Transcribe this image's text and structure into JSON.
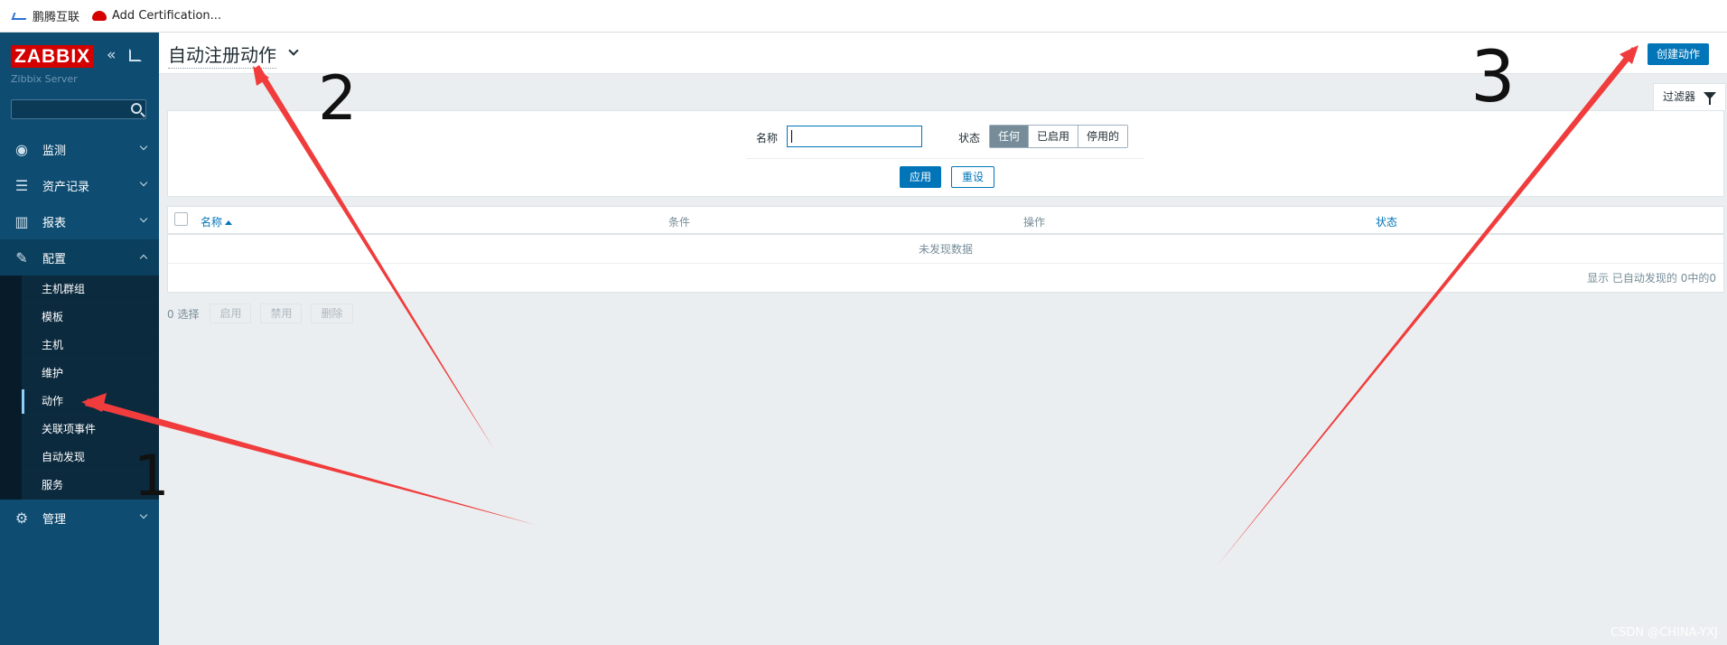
{
  "bookmarks": [
    {
      "label": "鹏腾互联",
      "icon": "blue-logo-icon"
    },
    {
      "label": "Add Certification...",
      "icon": "redhat-icon"
    }
  ],
  "sidebar": {
    "logo": "ZABBIX",
    "server_name": "Zibbix Server",
    "search_placeholder": "",
    "menu": [
      {
        "label": "监测",
        "icon": "eye-icon"
      },
      {
        "label": "资产记录",
        "icon": "list-icon"
      },
      {
        "label": "报表",
        "icon": "bar-chart-icon"
      },
      {
        "label": "配置",
        "icon": "wrench-icon"
      },
      {
        "label": "管理",
        "icon": "gear-icon"
      }
    ],
    "submenu": [
      "主机群组",
      "模板",
      "主机",
      "维护",
      "动作",
      "关联项事件",
      "自动发现",
      "服务"
    ]
  },
  "header": {
    "title": "自动注册动作",
    "create_button": "创建动作"
  },
  "filter": {
    "tab_label": "过滤器",
    "name_label": "名称",
    "name_value": "",
    "status_label": "状态",
    "status_options": [
      "任何",
      "已启用",
      "停用的"
    ],
    "status_selected": "任何",
    "apply": "应用",
    "reset": "重设"
  },
  "table": {
    "columns": [
      "名称",
      "条件",
      "操作",
      "状态"
    ],
    "empty_text": "未发现数据",
    "footer": "显示 已自动发现的 0中的0"
  },
  "bulk": {
    "selected": "0 选择",
    "enable": "启用",
    "disable": "禁用",
    "delete": "删除"
  },
  "annotations": [
    "1",
    "2",
    "3"
  ],
  "watermark": "CSDN @CHINA-YXJ",
  "colors": {
    "sidebar": "#0e4c72",
    "accent": "#0275b8",
    "logo": "#d40000",
    "arrow": "#f03c3c"
  }
}
